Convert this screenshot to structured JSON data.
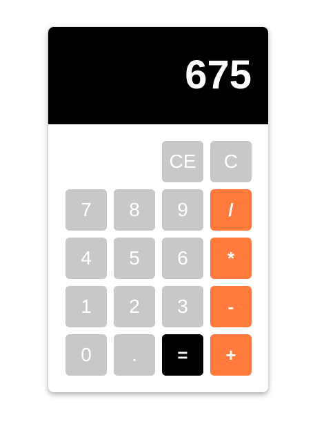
{
  "display": {
    "value": "675"
  },
  "keys": {
    "clear_entry": "CE",
    "clear": "C",
    "seven": "7",
    "eight": "8",
    "nine": "9",
    "divide": "/",
    "four": "4",
    "five": "5",
    "six": "6",
    "multiply": "*",
    "one": "1",
    "two": "2",
    "three": "3",
    "subtract": "-",
    "zero": "0",
    "decimal": ".",
    "equals": "=",
    "add": "+"
  },
  "colors": {
    "display_bg": "#000000",
    "digit_key": "#c8c8c8",
    "operator_key": "#ff7a3c",
    "equals_key": "#000000",
    "key_text": "#ffffff"
  }
}
